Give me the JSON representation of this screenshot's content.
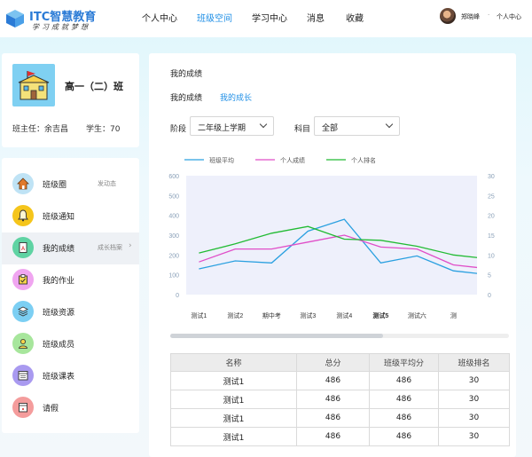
{
  "app": {
    "logo_title": "ITC智慧教育",
    "logo_slogan": "学习成就梦想",
    "accent": "#1f8fe6"
  },
  "nav": {
    "items": [
      "个人中心",
      "班级空间",
      "学习中心",
      "消息",
      "收藏"
    ],
    "active_index": 1
  },
  "user": {
    "name": "郑晓峰",
    "separator": "·",
    "center_label": "个人中心"
  },
  "class_info": {
    "name": "高一（二）班",
    "teacher": "班主任：余吉昌",
    "students": "学生：70",
    "badge_icon": "school-building-icon"
  },
  "sidebar": {
    "items": [
      {
        "label": "班级圈",
        "sub": "发动态",
        "icon": "house-icon",
        "icon_bg": "#bfe3f5",
        "glyph": "⌂",
        "active": false
      },
      {
        "label": "班级通知",
        "sub": "",
        "icon": "bell-icon",
        "icon_bg": "#f5c51b",
        "glyph": "🔔",
        "active": false
      },
      {
        "label": "我的成绩",
        "sub": "成长档案",
        "icon": "report-card-icon",
        "icon_bg": "#5fd3a3",
        "glyph": "A",
        "active": true
      },
      {
        "label": "我的作业",
        "sub": "",
        "icon": "homework-icon",
        "icon_bg": "#f0a5f0",
        "glyph": "✎",
        "active": false
      },
      {
        "label": "班级资源",
        "sub": "",
        "icon": "resources-icon",
        "icon_bg": "#7ccff3",
        "glyph": "❖",
        "active": false
      },
      {
        "label": "班级成员",
        "sub": "",
        "icon": "members-icon",
        "icon_bg": "#a7e69c",
        "glyph": "☺",
        "active": false
      },
      {
        "label": "班级课表",
        "sub": "",
        "icon": "timetable-icon",
        "icon_bg": "#a99af0",
        "glyph": "▤",
        "active": false
      },
      {
        "label": "请假",
        "sub": "",
        "icon": "leave-icon",
        "icon_bg": "#f49c9c",
        "glyph": "✚",
        "active": false
      }
    ],
    "arrow": "›"
  },
  "main": {
    "section_title": "我的成绩",
    "tabs": [
      "我的成绩",
      "我的成长"
    ],
    "active_tab": 1,
    "filters": {
      "stage_label": "阶段",
      "stage_value": "二年级上学期",
      "subject_label": "科目",
      "subject_value": "全部"
    }
  },
  "chart_data": {
    "type": "line",
    "categories": [
      "测试1",
      "测试2",
      "期中考",
      "测试3",
      "测试4",
      "测试5",
      "测试六",
      "测"
    ],
    "highlight_category": "测试5",
    "series": [
      {
        "name": "班级平均",
        "axis": "left",
        "color": "#2aa0e0",
        "values": [
          130,
          170,
          160,
          320,
          380,
          160,
          195,
          120,
          100
        ]
      },
      {
        "name": "个人成绩",
        "axis": "left",
        "color": "#e04ec8",
        "values": [
          165,
          230,
          230,
          265,
          300,
          240,
          230,
          150,
          130
        ]
      },
      {
        "name": "个人排名",
        "axis": "right",
        "color": "#22bb33",
        "values": [
          10.5,
          12.8,
          15.5,
          17.2,
          14,
          13.7,
          12.2,
          10,
          9
        ]
      }
    ],
    "y_left": {
      "min": 0,
      "max": 600,
      "ticks": [
        0,
        100,
        200,
        300,
        400,
        500,
        600
      ]
    },
    "y_right": {
      "min": 0,
      "max": 30,
      "ticks": [
        0,
        5,
        10,
        15,
        20,
        25,
        30
      ]
    },
    "grid": false,
    "legend_position": "top",
    "plot_bg": "#eef0fb"
  },
  "table": {
    "headers": [
      "名称",
      "总分",
      "班级平均分",
      "班级排名"
    ],
    "rows": [
      [
        "测试1",
        "486",
        "486",
        "30"
      ],
      [
        "测试1",
        "486",
        "486",
        "30"
      ],
      [
        "测试1",
        "486",
        "486",
        "30"
      ],
      [
        "测试1",
        "486",
        "486",
        "30"
      ]
    ]
  }
}
